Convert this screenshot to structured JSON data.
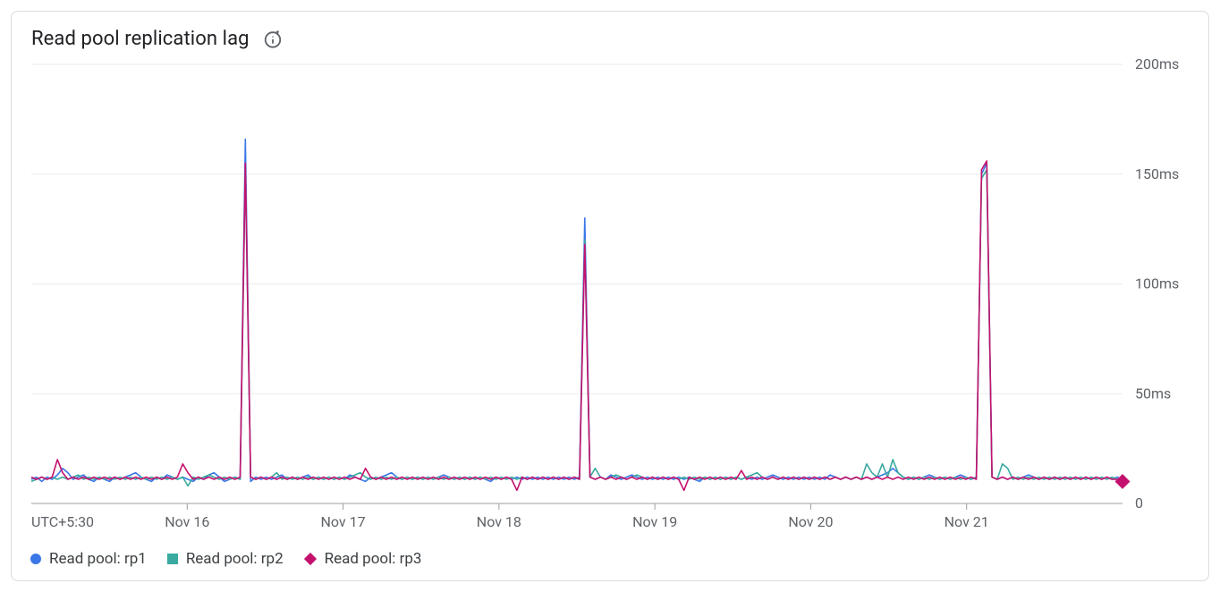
{
  "title": "Read pool replication lag",
  "timezone_label": "UTC+5:30",
  "icon_name": "info-refresh-icon",
  "legend": [
    {
      "label": "Read pool: rp1",
      "color": "#3b78e7",
      "marker": "circle"
    },
    {
      "label": "Read pool: rp2",
      "color": "#3aa99f",
      "marker": "square"
    },
    {
      "label": "Read pool: rp3",
      "color": "#c5116e",
      "marker": "diamond"
    }
  ],
  "chart_data": {
    "type": "line",
    "title": "Read pool replication lag",
    "xlabel": "",
    "ylabel": "",
    "ylim": [
      0,
      200
    ],
    "y_ticks": [
      0,
      50,
      100,
      150,
      200
    ],
    "y_tick_labels": [
      "0",
      "50ms",
      "100ms",
      "150ms",
      "200ms"
    ],
    "x_tick_labels": [
      "Nov 16",
      "Nov 17",
      "Nov 18",
      "Nov 19",
      "Nov 20",
      "Nov 21"
    ],
    "x_range": [
      0,
      210
    ],
    "x_tick_positions": [
      30,
      60,
      90,
      120,
      150,
      180
    ],
    "series": [
      {
        "name": "Read pool: rp1",
        "color": "#3b78e7",
        "values": [
          11,
          12,
          10,
          12,
          11,
          13,
          16,
          14,
          11,
          12,
          13,
          11,
          10,
          12,
          11,
          10,
          12,
          11,
          12,
          13,
          14,
          12,
          11,
          10,
          12,
          11,
          13,
          12,
          11,
          12,
          11,
          10,
          12,
          11,
          13,
          14,
          12,
          10,
          11,
          12,
          11,
          166,
          10,
          12,
          11,
          12,
          11,
          12,
          13,
          11,
          12,
          11,
          12,
          13,
          11,
          12,
          11,
          12,
          11,
          12,
          11,
          13,
          12,
          11,
          10,
          12,
          11,
          12,
          13,
          14,
          12,
          11,
          12,
          11,
          12,
          11,
          12,
          11,
          12,
          13,
          12,
          11,
          12,
          11,
          12,
          11,
          12,
          11,
          10,
          12,
          11,
          12,
          11,
          12,
          11,
          12,
          11,
          12,
          11,
          12,
          11,
          12,
          11,
          12,
          11,
          12,
          130,
          12,
          11,
          12,
          11,
          13,
          12,
          11,
          12,
          13,
          12,
          11,
          12,
          11,
          12,
          11,
          12,
          11,
          12,
          11,
          12,
          11,
          10,
          12,
          11,
          12,
          11,
          12,
          11,
          12,
          11,
          12,
          11,
          12,
          11,
          12,
          13,
          12,
          11,
          12,
          11,
          12,
          11,
          12,
          11,
          12,
          11,
          13,
          12,
          11,
          12,
          11,
          12,
          11,
          12,
          11,
          12,
          13,
          14,
          16,
          14,
          12,
          11,
          12,
          11,
          12,
          13,
          12,
          11,
          12,
          11,
          12,
          13,
          12,
          11,
          12,
          150,
          155,
          12,
          11,
          12,
          11,
          12,
          11,
          12,
          13,
          12,
          11,
          12,
          11,
          12,
          11,
          12,
          11,
          12,
          11,
          12,
          11,
          12,
          11,
          12,
          11,
          12,
          11
        ]
      },
      {
        "name": "Read pool: rp2",
        "color": "#3aa99f",
        "values": [
          10,
          11,
          12,
          11,
          12,
          11,
          12,
          11,
          12,
          13,
          11,
          12,
          11,
          12,
          11,
          12,
          11,
          12,
          11,
          12,
          11,
          12,
          11,
          12,
          11,
          12,
          11,
          12,
          11,
          12,
          8,
          12,
          11,
          12,
          13,
          12,
          11,
          12,
          11,
          12,
          11,
          152,
          12,
          11,
          12,
          11,
          12,
          14,
          11,
          12,
          11,
          12,
          11,
          12,
          11,
          12,
          11,
          12,
          11,
          12,
          11,
          12,
          13,
          14,
          12,
          11,
          12,
          11,
          12,
          11,
          12,
          11,
          12,
          11,
          12,
          11,
          12,
          11,
          12,
          11,
          12,
          11,
          12,
          11,
          12,
          11,
          12,
          11,
          12,
          11,
          12,
          11,
          12,
          11,
          12,
          11,
          12,
          11,
          12,
          11,
          12,
          11,
          12,
          11,
          12,
          11,
          120,
          12,
          16,
          12,
          11,
          12,
          13,
          12,
          11,
          12,
          13,
          12,
          11,
          12,
          11,
          12,
          11,
          12,
          11,
          12,
          11,
          12,
          11,
          12,
          11,
          12,
          11,
          12,
          11,
          12,
          11,
          12,
          13,
          14,
          12,
          11,
          12,
          11,
          12,
          11,
          12,
          11,
          12,
          11,
          12,
          11,
          12,
          11,
          12,
          11,
          12,
          11,
          12,
          11,
          18,
          14,
          12,
          18,
          12,
          20,
          14,
          12,
          11,
          12,
          11,
          12,
          11,
          12,
          11,
          12,
          11,
          12,
          11,
          12,
          11,
          12,
          148,
          152,
          12,
          11,
          18,
          16,
          11,
          12,
          11,
          12,
          11,
          12,
          11,
          12,
          11,
          12,
          11,
          12,
          11,
          12,
          11,
          12,
          11,
          12,
          11,
          12,
          11,
          11
        ]
      },
      {
        "name": "Read pool: rp3",
        "color": "#c5116e",
        "values": [
          12,
          11,
          12,
          11,
          12,
          20,
          14,
          11,
          12,
          11,
          12,
          11,
          12,
          11,
          12,
          11,
          12,
          11,
          12,
          11,
          12,
          11,
          12,
          11,
          12,
          11,
          12,
          11,
          12,
          18,
          14,
          11,
          12,
          11,
          12,
          11,
          12,
          11,
          12,
          11,
          12,
          155,
          12,
          11,
          12,
          11,
          12,
          11,
          12,
          11,
          12,
          11,
          12,
          11,
          12,
          11,
          12,
          11,
          12,
          11,
          12,
          11,
          12,
          11,
          16,
          12,
          11,
          12,
          11,
          12,
          11,
          12,
          11,
          12,
          11,
          12,
          11,
          12,
          11,
          12,
          11,
          12,
          11,
          12,
          11,
          12,
          11,
          12,
          11,
          12,
          11,
          12,
          11,
          6,
          12,
          11,
          12,
          11,
          12,
          11,
          12,
          11,
          12,
          11,
          12,
          11,
          118,
          12,
          11,
          12,
          11,
          12,
          11,
          12,
          11,
          12,
          11,
          12,
          11,
          12,
          11,
          12,
          11,
          12,
          11,
          6,
          12,
          11,
          12,
          11,
          12,
          11,
          12,
          11,
          12,
          11,
          15,
          11,
          12,
          11,
          12,
          11,
          12,
          11,
          12,
          11,
          12,
          11,
          12,
          11,
          12,
          11,
          12,
          11,
          12,
          11,
          12,
          11,
          12,
          11,
          12,
          11,
          12,
          11,
          12,
          11,
          12,
          11,
          12,
          11,
          12,
          11,
          12,
          11,
          12,
          11,
          12,
          11,
          12,
          11,
          12,
          11,
          152,
          156,
          12,
          11,
          12,
          11,
          12,
          11,
          12,
          11,
          12,
          11,
          12,
          11,
          12,
          11,
          12,
          11,
          12,
          11,
          12,
          11,
          12,
          11,
          12,
          11,
          11,
          10
        ]
      }
    ]
  }
}
